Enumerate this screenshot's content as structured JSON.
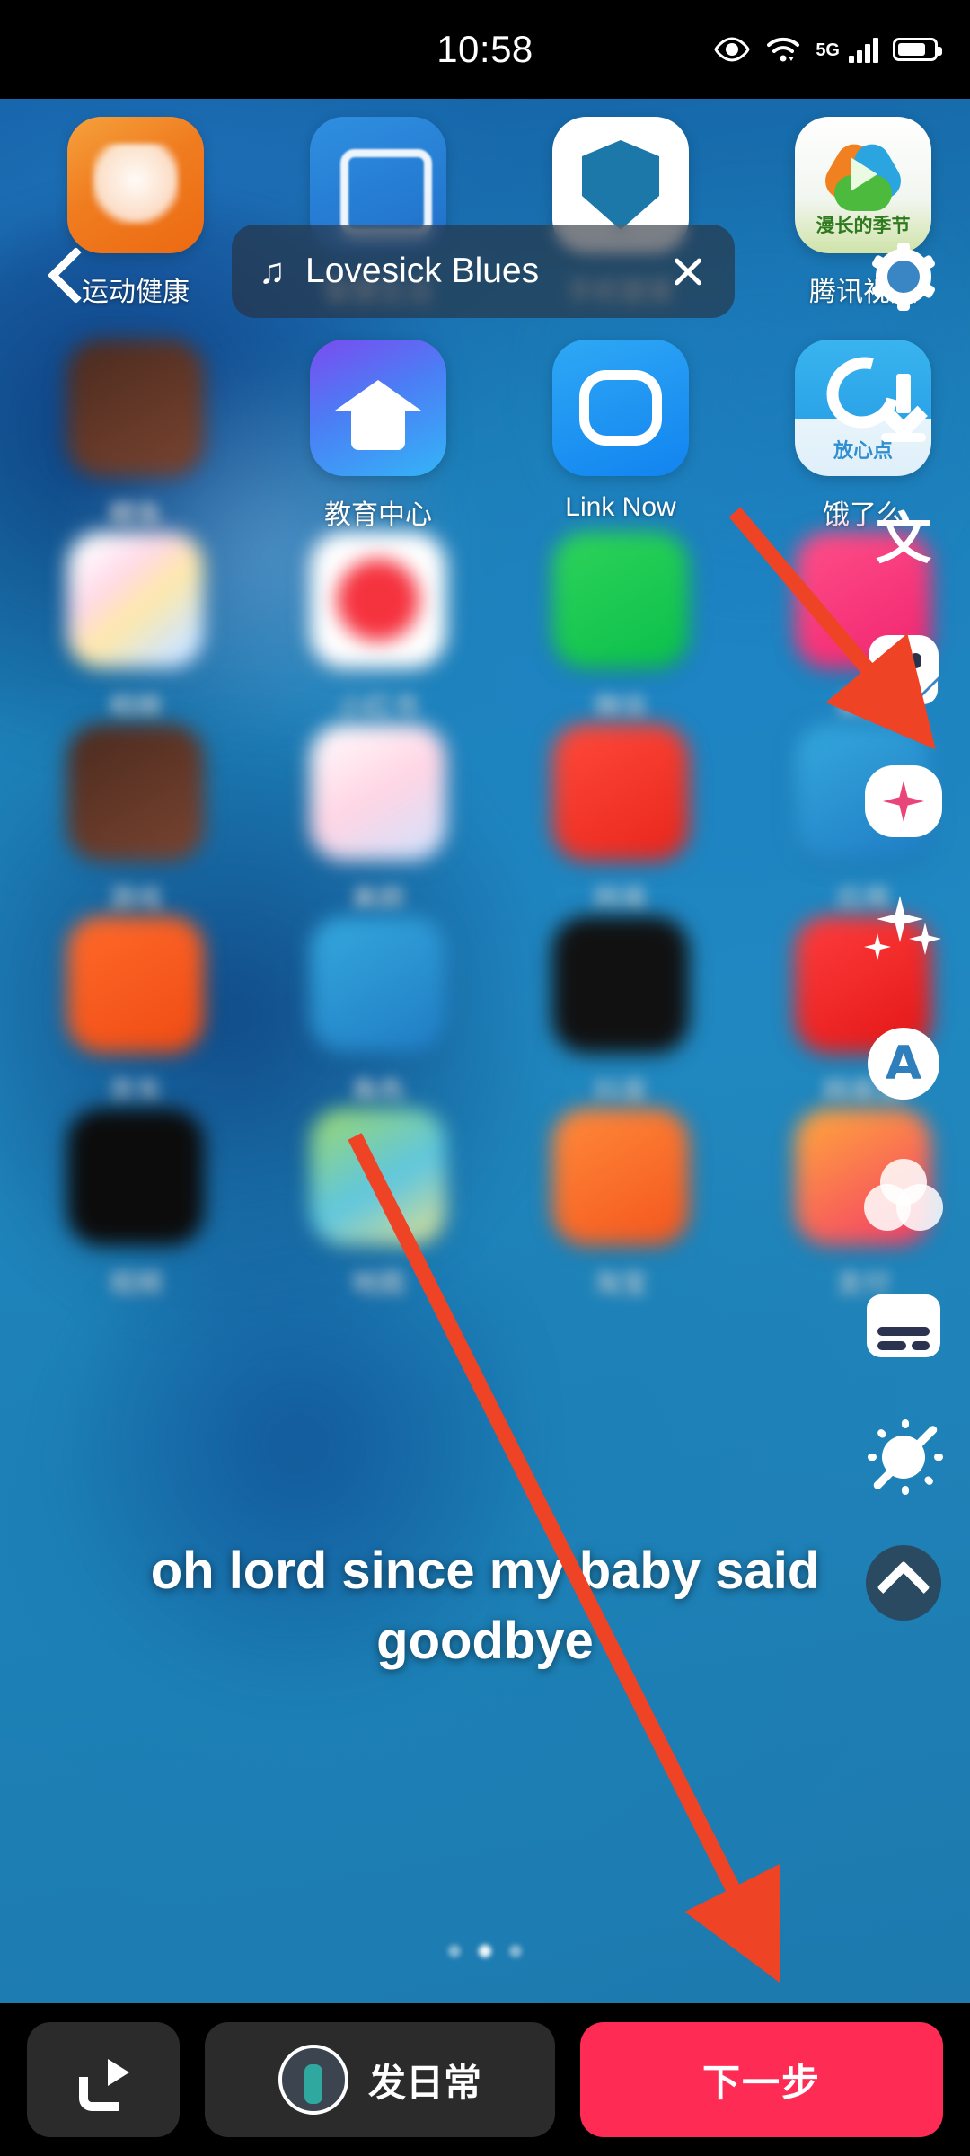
{
  "status_bar": {
    "time": "10:58",
    "icons": [
      "eye-care-icon",
      "wifi-icon",
      "5g-icon",
      "signal-bars-icon",
      "battery-icon"
    ],
    "network_label": "5G"
  },
  "now_playing": {
    "music_note": "♫",
    "title": "Lovesick Blues",
    "close_label": "×"
  },
  "back_button": {
    "label": "‹"
  },
  "tool_rail": [
    {
      "name": "gear-icon",
      "label": ""
    },
    {
      "name": "download-icon",
      "label": ""
    },
    {
      "name": "text-cn-icon",
      "label": "文"
    },
    {
      "name": "sticker-icon",
      "label": ""
    },
    {
      "name": "beauty-icon",
      "label": ""
    },
    {
      "name": "sparkles-icon",
      "label": ""
    },
    {
      "name": "text-style-icon",
      "label": "A"
    },
    {
      "name": "filters-icon",
      "label": ""
    },
    {
      "name": "captions-icon",
      "label": ""
    },
    {
      "name": "auto-enhance-off-icon",
      "label": ""
    },
    {
      "name": "collapse-icon",
      "label": ""
    }
  ],
  "home_screen": {
    "rows": [
      [
        {
          "label": "运动健康",
          "icon": "ic-health",
          "blurred": false
        },
        {
          "label": "智慧生活",
          "icon": "ic-life",
          "blurred": false
        },
        {
          "label": "手机管家",
          "icon": "ic-guard",
          "blurred": false
        },
        {
          "label": "腾讯视频",
          "icon": "ic-tx",
          "blurred": false
        }
      ],
      [
        {
          "label": "鲤鱼",
          "icon": "ic-p5",
          "blurred": true
        },
        {
          "label": "教育中心",
          "icon": "ic-edu",
          "blurred": false
        },
        {
          "label": "Link Now",
          "icon": "ic-link",
          "blurred": false
        },
        {
          "label": "饿了么",
          "icon": "ic-ele",
          "blurred": false
        }
      ],
      [
        {
          "label": "相册",
          "icon": "ic-p1",
          "blurred": true
        },
        {
          "label": "小红书",
          "icon": "ic-p2",
          "blurred": true
        },
        {
          "label": "微信",
          "icon": "ic-p3",
          "blurred": true
        },
        {
          "label": "美图",
          "icon": "ic-p4",
          "blurred": true
        }
      ],
      [
        {
          "label": "游戏",
          "icon": "ic-p5",
          "blurred": true
        },
        {
          "label": "美颜",
          "icon": "ic-p6",
          "blurred": true
        },
        {
          "label": "网易",
          "icon": "ic-p7",
          "blurred": true
        },
        {
          "label": "应用",
          "icon": "ic-p9",
          "blurred": true
        }
      ],
      [
        {
          "label": "京东",
          "icon": "ic-p8",
          "blurred": true
        },
        {
          "label": "角色",
          "icon": "ic-p9",
          "blurred": true
        },
        {
          "label": "抖音",
          "icon": "ic-p10",
          "blurred": true
        },
        {
          "label": "网易云",
          "icon": "ic-p11",
          "blurred": true
        }
      ],
      [
        {
          "label": "视频",
          "icon": "ic-p12",
          "blurred": true
        },
        {
          "label": "地图",
          "icon": "ic-p13",
          "blurred": true
        },
        {
          "label": "淘宝",
          "icon": "ic-p14",
          "blurred": true
        },
        {
          "label": "支付",
          "icon": "ic-p15",
          "blurred": true
        }
      ]
    ],
    "page_dots": {
      "count": 3,
      "active_index": 1
    }
  },
  "lyrics": {
    "line1": "oh lord since my baby said",
    "line2": "goodbye"
  },
  "annotations": {
    "arrow1": {
      "name": "arrow-to-video-icon",
      "color": "#ef4326"
    },
    "arrow2": {
      "name": "arrow-to-next-button",
      "color": "#ef4326"
    }
  },
  "bottom_bar": {
    "share_label": "",
    "daily_label": "发日常",
    "next_label": "下一步",
    "next_color": "#fe2c55"
  }
}
